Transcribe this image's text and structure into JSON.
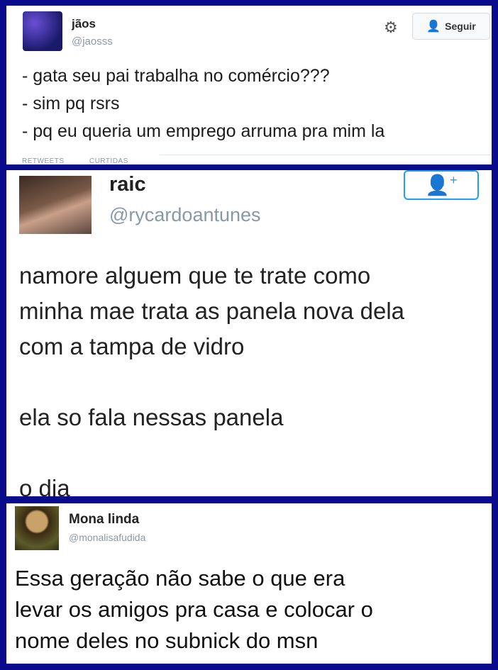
{
  "tweets": [
    {
      "name": "jãos",
      "handle": "@jaosss",
      "follow_label": "Seguir",
      "text": "- gata seu pai trabalha no comércio???\n- sim pq rsrs\n- pq eu queria um emprego arruma pra mim la",
      "stats": [
        "RETWEETS",
        "CURTIDAS"
      ]
    },
    {
      "name": "raic",
      "handle": "@rycardoantunes",
      "text": "namore alguem que te trate como\nminha mae trata as panela nova dela\ncom a tampa de vidro\n\nela so fala nessas panela\n\no dia"
    },
    {
      "name": "Mona linda",
      "handle": "@monalisafudida",
      "text": "Essa geração não sabe o que era\nlevar os amigos pra casa e colocar o\nnome deles no subnick do msn"
    }
  ],
  "colors": {
    "frame": "#0a0a8c",
    "accent": "#1da1f2"
  },
  "icons": [
    "gear-icon",
    "follow-person-icon",
    "add-user-icon"
  ]
}
